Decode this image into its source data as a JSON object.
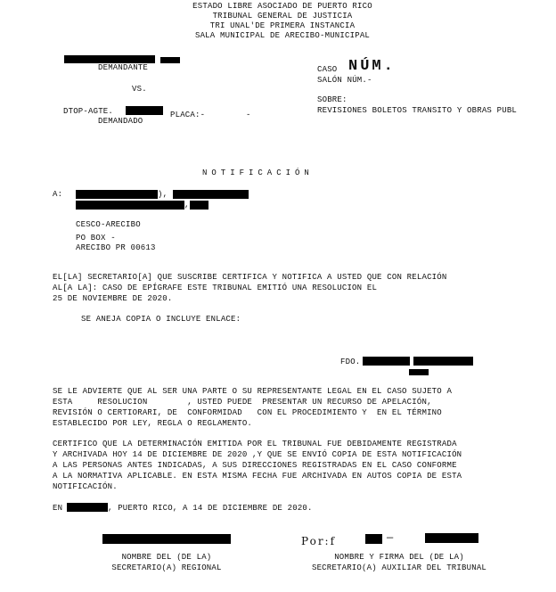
{
  "header": {
    "line1": "ESTADO LIBRE ASOCIADO DE PUERTO RICO",
    "line2": "TRIBUNAL GENERAL DE JUSTICIA",
    "line3": "TRI UNAL'DE PRIMERA INSTANCIA",
    "line4": "SALA MUNICIPAL DE ARECIBO-MUNICIPAL"
  },
  "caption": {
    "demandante": "DEMANDANTE",
    "vs": "VS.",
    "dtop": "DTOP-AGTE.",
    "placa": "PLACA:-",
    "placa_dash": "-",
    "demandado": "DEMANDADO",
    "caso_label": "CASO",
    "caso_num": "NÚM.",
    "salon": "SALÓN NÚM.-",
    "sobre_label": "SOBRE:",
    "sobre_text": "REVISIONES BOLETOS TRANSITO Y OBRAS PUBL"
  },
  "notice": {
    "title": "NOTIFICACIÓN",
    "to_label": "A:",
    "comma1": "),",
    "comma2": ",",
    "addr1": "CESCO-ARECIBO",
    "addr2": "PO BOX -",
    "addr3": "ARECIBO PR 00613"
  },
  "body": {
    "p1_l1": "EL[LA] SECRETARIO[A] QUE SUSCRIBE CERTIFICA Y NOTIFICA A USTED QUE CON RELACIÓN",
    "p1_l2": "AL[A LA]: CASO DE EPÍGRAFE ESTE TRIBUNAL EMITIÓ UNA RESOLUCION EL",
    "p1_l3": "25 DE NOVIEMBRE DE 2020.",
    "p2": "SE ANEJA COPIA O INCLUYE ENLACE:",
    "fdo": "FDO.",
    "p3_l1": "SE LE ADVIERTE QUE AL SER UNA PARTE O SU REPRESENTANTE LEGAL EN EL CASO SUJETO A",
    "p3_l2": "ESTA     RESOLUCION        , USTED PUEDE  PRESENTAR UN RECURSO DE APELACIÓN,",
    "p3_l3": "REVISIÓN O CERTIORARI, DE  CONFORMIDAD   CON EL PROCEDIMIENTO Y  EN EL TÉRMINO",
    "p3_l4": "ESTABLECIDO POR LEY, REGLA O REGLAMENTO.",
    "p4_l1": "CERTIFICO QUE LA DETERMINACIÓN EMITIDA POR EL TRIBUNAL FUE DEBIDAMENTE REGISTRADA",
    "p4_l2": "Y ARCHIVADA HOY 14 DE DICIEMBRE DE 2020 ,Y QUE SE ENVIÓ COPIA DE ESTA NOTIFICACIÓN",
    "p4_l3": "A LAS PERSONAS ANTES INDICADAS, A SUS DIRECCIONES REGISTRADAS EN EL CASO CONFORME",
    "p4_l4": "A LA NORMATIVA APLICABLE. EN ESTA MISMA FECHA FUE ARCHIVADA EN AUTOS COPIA DE ESTA",
    "p4_l5": "NOTIFICACIÓN.",
    "en": "EN",
    "place_date": ", PUERTO RICO, A 14 DE DICIEMBRE DE 2020."
  },
  "signatures": {
    "por": "Por:f",
    "por_dash": "—",
    "left_l1": "NOMBRE DEL (DE LA)",
    "left_l2": "SECRETARIO(A) REGIONAL",
    "right_l1": "NOMBRE Y FIRMA DEL (DE LA)",
    "right_l2": "SECRETARIO(A) AUXILIAR DEL TRIBUNAL"
  }
}
